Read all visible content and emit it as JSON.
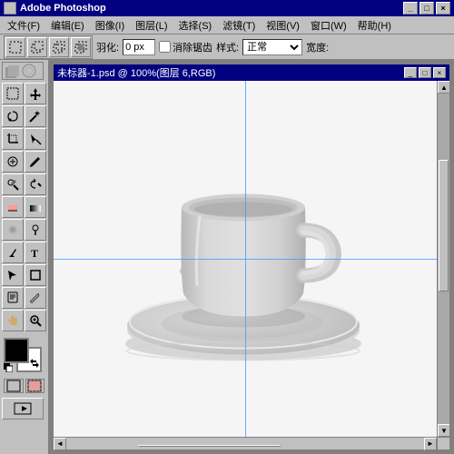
{
  "app": {
    "title": "Adobe Photoshop",
    "icon": "ps"
  },
  "titlebar": {
    "title": "Adobe Photoshop",
    "minimize": "_",
    "maximize": "□",
    "close": "×"
  },
  "menubar": {
    "items": [
      {
        "label": "文件(F)"
      },
      {
        "label": "编辑(E)"
      },
      {
        "label": "图像(I)"
      },
      {
        "label": "图层(L)"
      },
      {
        "label": "选择(S)"
      },
      {
        "label": "滤镜(T)"
      },
      {
        "label": "视图(V)"
      },
      {
        "label": "窗口(W)"
      },
      {
        "label": "帮助(H)"
      }
    ]
  },
  "optionsbar": {
    "feather_label": "羽化:",
    "feather_value": "0 px",
    "anti_alias_label": "消除锯齿",
    "style_label": "样式:",
    "style_value": "正常",
    "width_label": "宽度:"
  },
  "docwindow": {
    "title": "未标器-1.psd @ 100%(图层 6,RGB)",
    "minimize": "_",
    "maximize": "□",
    "close": "×"
  },
  "tools": [
    {
      "icon": "⬚",
      "name": "marquee",
      "active": false
    },
    {
      "icon": "↖",
      "name": "move",
      "active": false
    },
    {
      "icon": "⬡",
      "name": "lasso",
      "active": false
    },
    {
      "icon": "✂",
      "name": "crop",
      "active": false
    },
    {
      "icon": "✒",
      "name": "pen",
      "active": false
    },
    {
      "icon": "⬜",
      "name": "type",
      "active": false
    },
    {
      "icon": "◈",
      "name": "shape",
      "active": false
    },
    {
      "icon": "✏",
      "name": "brush",
      "active": false
    },
    {
      "icon": "⊕",
      "name": "clone",
      "active": false
    },
    {
      "icon": "◻",
      "name": "eraser",
      "active": false
    },
    {
      "icon": "▤",
      "name": "gradient",
      "active": false
    },
    {
      "icon": "☁",
      "name": "blur",
      "active": false
    },
    {
      "icon": "◐",
      "name": "dodge",
      "active": false
    },
    {
      "icon": "✋",
      "name": "hand",
      "active": false
    },
    {
      "icon": "🔍",
      "name": "zoom",
      "active": false
    }
  ],
  "colors": {
    "foreground": "#000000",
    "background": "#ffffff",
    "accent_blue": "#4499ff",
    "guide_blue": "#4499ee"
  },
  "canvas": {
    "zoom": "100%",
    "layer": "图层 6",
    "mode": "RGB"
  }
}
